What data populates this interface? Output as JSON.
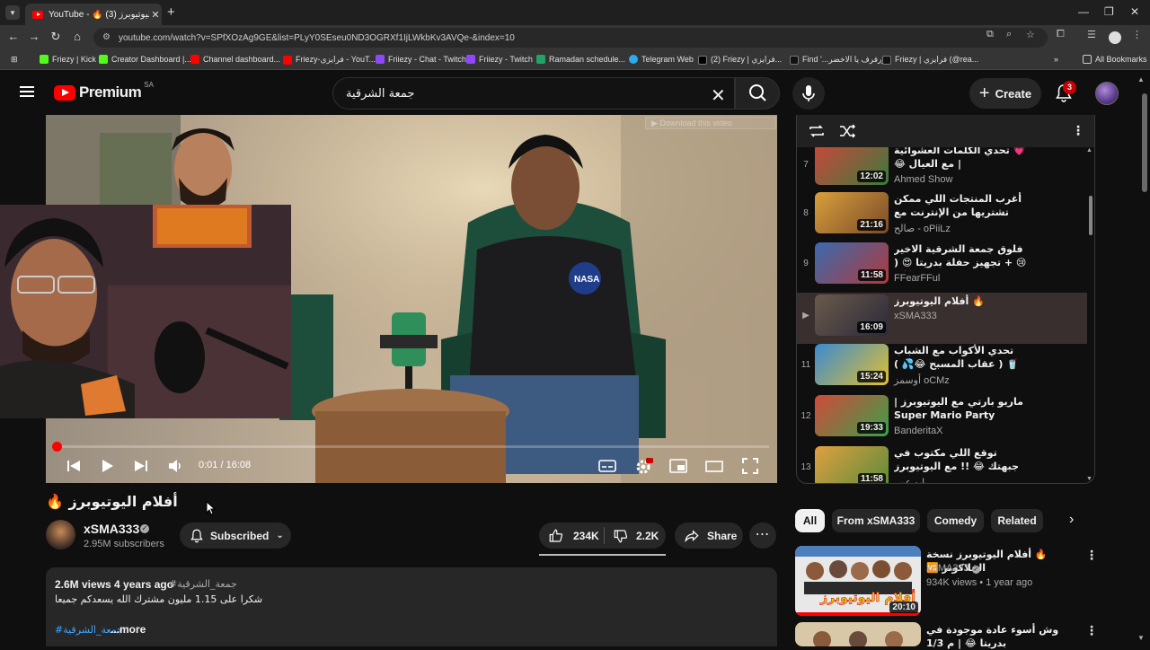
{
  "browser": {
    "tab_title": "YouTube - 🔥 أفلام اليوتيوبرز (3)",
    "new_tab": "+",
    "url": "youtube.com/watch?v=SPfXOzAg9GE&list=PLyY0SEseu0ND3OGRXf1IjLWkbKv3AVQe-&index=10",
    "window_controls": {
      "minimize": "—",
      "restore": "❐",
      "close": "✕"
    }
  },
  "bookmarks": [
    {
      "label": "Friezy | Kick",
      "color": "#53fc18"
    },
    {
      "label": "Creator Dashboard |...",
      "color": "#53fc18"
    },
    {
      "label": "Channel dashboard...",
      "color": "#ff0000"
    },
    {
      "label": "Friezy-فرايزي - YouT...",
      "color": "#ff0000"
    },
    {
      "label": "Friiezy - Chat - Twitch",
      "color": "#9146ff"
    },
    {
      "label": "Friiezy - Twitch",
      "color": "#9146ff"
    },
    {
      "label": "Ramadan schedule...",
      "color": "#1fa463"
    },
    {
      "label": "Telegram Web",
      "color": "#2aabee"
    },
    {
      "label": "(2) Friezy | فرايزي...",
      "color": "#ffffff"
    },
    {
      "label": "Find '...زرفرف يا الاخضر",
      "color": "#111111"
    },
    {
      "label": "Friezy | فرايزي (@rea...",
      "color": "#111111"
    }
  ],
  "bookmarks_more": "»",
  "all_bookmarks": "All Bookmarks",
  "header": {
    "logo_text": "Premium",
    "country": "SA",
    "search_value": "جمعة الشرقية",
    "create_label": "Create",
    "notif_count": "3"
  },
  "player": {
    "time": "0:01 / 16:08",
    "progress": 0.001,
    "download_hint": "Download this video"
  },
  "video": {
    "title": "🔥 أفلام اليوتيوبرز",
    "channel": "xSMA333",
    "subscribers": "2.95M subscribers",
    "subscribe_label": "Subscribed",
    "likes": "234K",
    "dislikes": "2.2K",
    "share_label": "Share",
    "more_label": "⋯"
  },
  "description": {
    "meta": "2.6M views  4 years ago",
    "hashtag": "#جمعة_الشرقية",
    "text": "شكرا على 1.15 مليون مشترك الله يسعدكم جميعا",
    "tag_line": "#جمعة_الشرقية",
    "more": "...more"
  },
  "playlist": {
    "items": [
      {
        "index": "7",
        "title": "💗 تحدي الكلمات العشوائية | مع العيال 😂",
        "channel": "Ahmed Show",
        "duration": "12:02",
        "c1": "#c9483a",
        "c2": "#3b7a3e"
      },
      {
        "index": "8",
        "title": "أغرب المنتجات اللي ممكن تشتريها من الإنترنت مع اليوتيوبرز",
        "channel": "صالح - oPiiLz",
        "duration": "21:16",
        "c1": "#d8a03a",
        "c2": "#7a4a2a"
      },
      {
        "index": "9",
        "title": "فلوق جمعة الشرقية الاخير 😢 + تجهيز حفلة بدريتا 😍 ( وداعا لليوتيوبرز 💔 )",
        "channel": "FFearFFul",
        "duration": "11:58",
        "c1": "#3a6ab0",
        "c2": "#b03a3a"
      },
      {
        "index": "▶",
        "title": "🔥 أفلام اليوتيوبرز",
        "channel": "xSMA333",
        "duration": "16:09",
        "c1": "#6a5a4a",
        "c2": "#2a2a3a",
        "active": true
      },
      {
        "index": "11",
        "title": "تحدي الأكواب مع الشباب 🥤 ( عقاب المسبح 😂💦 )",
        "channel": "أوسمز oCMz",
        "duration": "15:24",
        "c1": "#3a8ad0",
        "c2": "#e0c030"
      },
      {
        "index": "12",
        "title": "ماريو بارتي مع اليوتيوبرز | Super Mario Party",
        "channel": "BanderitaX",
        "duration": "19:33",
        "c1": "#d04a3a",
        "c2": "#3aa04a"
      },
      {
        "index": "13",
        "title": "توقع اللي مكتوب في جبهتك 😂 !! مع اليوتيوبرز",
        "channel": "ابو عبير",
        "duration": "11:58",
        "c1": "#e0a040",
        "c2": "#5a8a3a"
      }
    ]
  },
  "chips": [
    {
      "label": "All",
      "selected": true
    },
    {
      "label": "From xSMA333"
    },
    {
      "label": "Comedy"
    },
    {
      "label": "Related"
    }
  ],
  "related": [
    {
      "title": "🔥 أفلام اليوتيوبرز نسخة الفلاكونز 🆚",
      "channel": "xSMA333",
      "meta": "934K views  •  1 year ago",
      "duration": "20:10",
      "thumb_text": "أفلام اليوتيوبرز"
    },
    {
      "title": "وش أسوء عادة موجودة في بدريتا 😂 | م 1/3",
      "channel": "",
      "meta": "",
      "duration": ""
    }
  ]
}
